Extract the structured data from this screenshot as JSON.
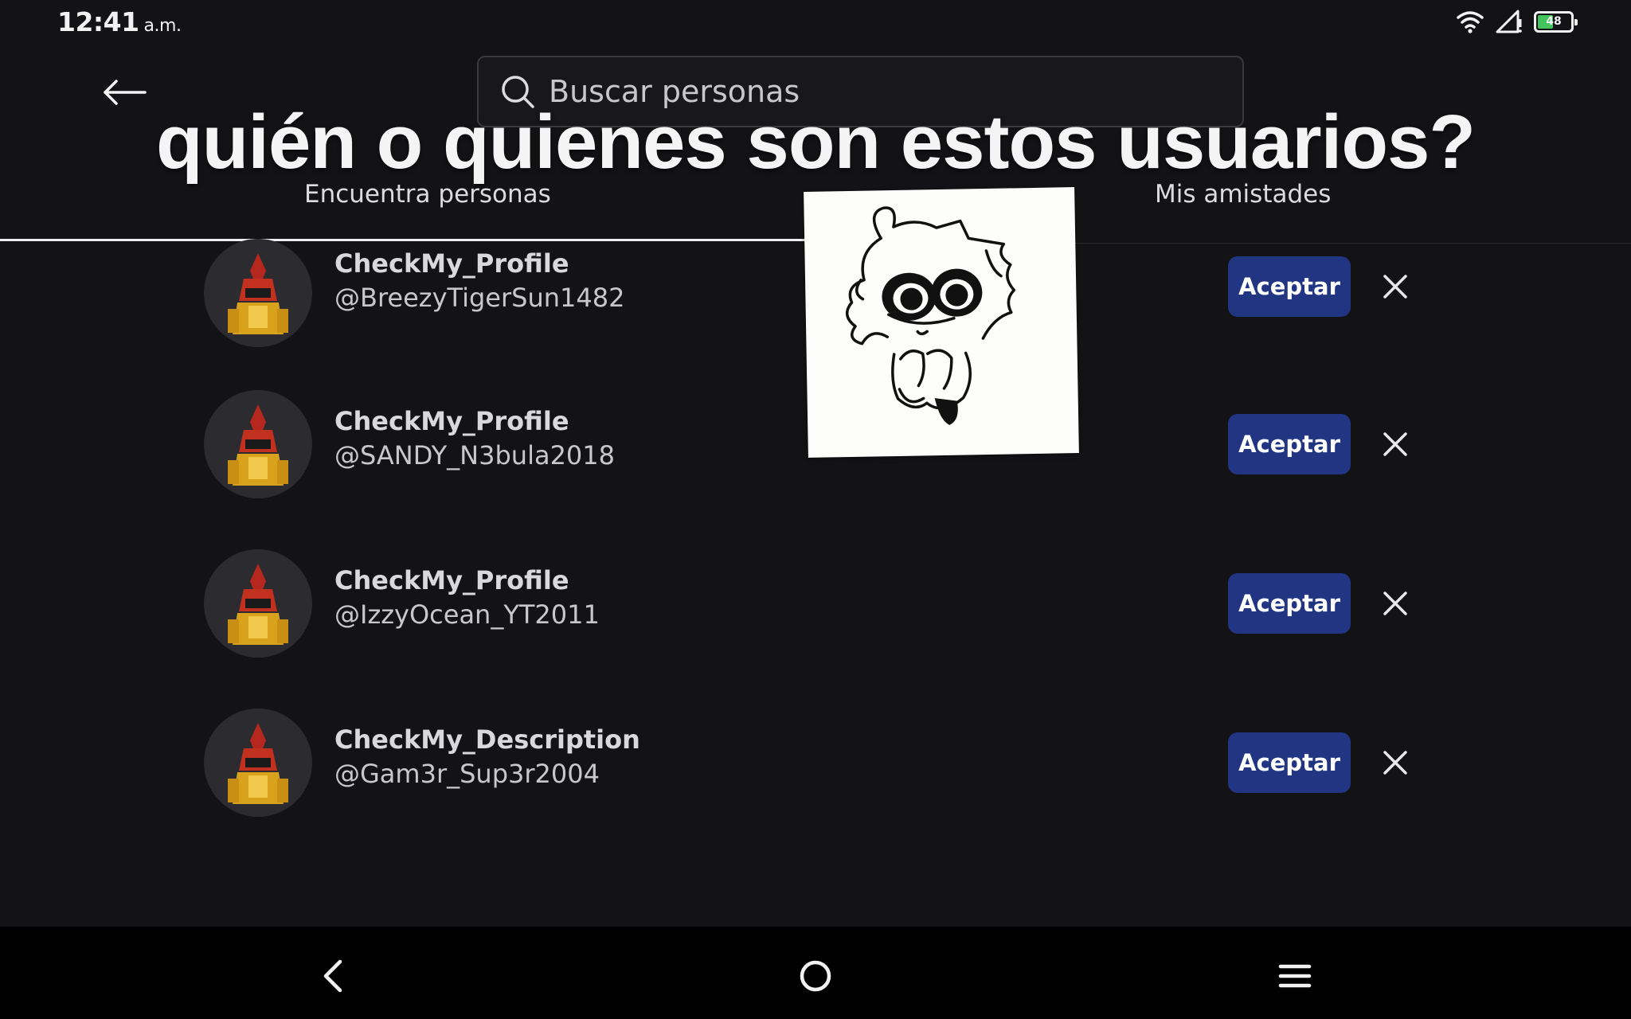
{
  "status_bar": {
    "time": "12:41",
    "ampm": "a.m.",
    "battery_level": "48",
    "icons": [
      "wifi-icon",
      "cell-signal-icon",
      "battery-icon"
    ]
  },
  "header": {
    "back_icon": "arrow-left-icon",
    "search_placeholder": "Buscar personas",
    "search_icon": "search-icon"
  },
  "overlay": {
    "caption": "quién o quienes son estos usuarios?",
    "sticker": "hand-drawn-character-sticker"
  },
  "tabs": [
    {
      "label": "Encuentra personas",
      "active": true
    },
    {
      "label": "Mis amistades",
      "active": false
    }
  ],
  "requests": [
    {
      "display_name": "CheckMy_Profile",
      "username": "@BreezyTigerSun1482",
      "accept_label": "Aceptar"
    },
    {
      "display_name": "CheckMy_Profile",
      "username": "@SANDY_N3bula2018",
      "accept_label": "Aceptar"
    },
    {
      "display_name": "CheckMy_Profile",
      "username": "@IzzyOcean_YT2011",
      "accept_label": "Aceptar"
    },
    {
      "display_name": "CheckMy_Description",
      "username": "@Gam3r_Sup3r2004",
      "accept_label": "Aceptar"
    }
  ],
  "nav_bar": {
    "icons": [
      "nav-back-icon",
      "nav-home-icon",
      "nav-menu-icon"
    ]
  },
  "colors": {
    "background": "#131316",
    "accept_button": "#213583",
    "nav_bar": "#000000"
  }
}
